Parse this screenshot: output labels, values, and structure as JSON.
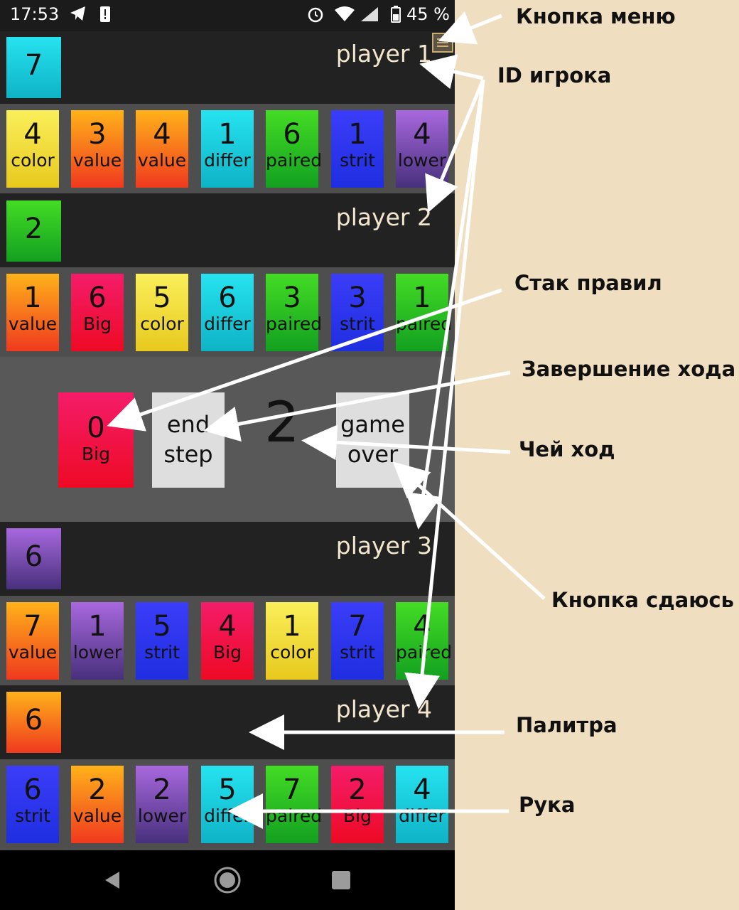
{
  "status_bar": {
    "time": "17:53",
    "battery": "45 %"
  },
  "colors": {
    "cyan": "#1ccbdb",
    "yellow": "#f3e03a",
    "orange": "#f7761c",
    "green": "#2bc022",
    "blue": "#2d36ec",
    "purple": "#7a4cb0",
    "red": "#f11448",
    "background_note": "#f0dec0"
  },
  "players": [
    {
      "label": "player 1",
      "palette": {
        "value": "7",
        "color": "cyan"
      },
      "hand": [
        {
          "value": "4",
          "rule": "color",
          "color": "yellow"
        },
        {
          "value": "3",
          "rule": "value",
          "color": "orange"
        },
        {
          "value": "4",
          "rule": "value",
          "color": "orange"
        },
        {
          "value": "1",
          "rule": "differ",
          "color": "cyan"
        },
        {
          "value": "6",
          "rule": "paired",
          "color": "green"
        },
        {
          "value": "1",
          "rule": "strit",
          "color": "blue"
        },
        {
          "value": "4",
          "rule": "lower",
          "color": "purple"
        }
      ]
    },
    {
      "label": "player 2",
      "palette": {
        "value": "2",
        "color": "green"
      },
      "hand": [
        {
          "value": "1",
          "rule": "value",
          "color": "orange"
        },
        {
          "value": "6",
          "rule": "Big",
          "color": "red"
        },
        {
          "value": "5",
          "rule": "color",
          "color": "yellow"
        },
        {
          "value": "6",
          "rule": "differ",
          "color": "cyan"
        },
        {
          "value": "3",
          "rule": "paired",
          "color": "green"
        },
        {
          "value": "3",
          "rule": "strit",
          "color": "blue"
        },
        {
          "value": "1",
          "rule": "paired",
          "color": "green"
        }
      ]
    },
    {
      "label": "player 3",
      "palette": {
        "value": "6",
        "color": "purple"
      },
      "hand": [
        {
          "value": "7",
          "rule": "value",
          "color": "orange"
        },
        {
          "value": "1",
          "rule": "lower",
          "color": "purple"
        },
        {
          "value": "5",
          "rule": "strit",
          "color": "blue"
        },
        {
          "value": "4",
          "rule": "Big",
          "color": "red"
        },
        {
          "value": "1",
          "rule": "color",
          "color": "yellow"
        },
        {
          "value": "7",
          "rule": "strit",
          "color": "blue"
        },
        {
          "value": "4",
          "rule": "paired",
          "color": "green"
        }
      ]
    },
    {
      "label": "player 4",
      "palette": {
        "value": "6",
        "color": "orange"
      },
      "hand": [
        {
          "value": "6",
          "rule": "strit",
          "color": "blue"
        },
        {
          "value": "2",
          "rule": "value",
          "color": "orange"
        },
        {
          "value": "2",
          "rule": "lower",
          "color": "purple"
        },
        {
          "value": "5",
          "rule": "differ",
          "color": "cyan"
        },
        {
          "value": "7",
          "rule": "paired",
          "color": "green"
        },
        {
          "value": "2",
          "rule": "Big",
          "color": "red"
        },
        {
          "value": "4",
          "rule": "differ",
          "color": "cyan"
        }
      ]
    }
  ],
  "center": {
    "rule_stack": {
      "value": "0",
      "rule": "Big",
      "color": "red"
    },
    "end_step": {
      "line1": "end",
      "line2": "step"
    },
    "turn": "2",
    "game_over": {
      "line1": "game",
      "line2": "over"
    }
  },
  "annotations": {
    "menu_button": "Кнопка меню",
    "player_id": "ID игрока",
    "rule_stack": "Стак правил",
    "end_turn": "Завершение хода",
    "whose_turn": "Чей ход",
    "surrender": "Кнопка сдаюсь",
    "palette": "Палитра",
    "hand": "Рука"
  }
}
